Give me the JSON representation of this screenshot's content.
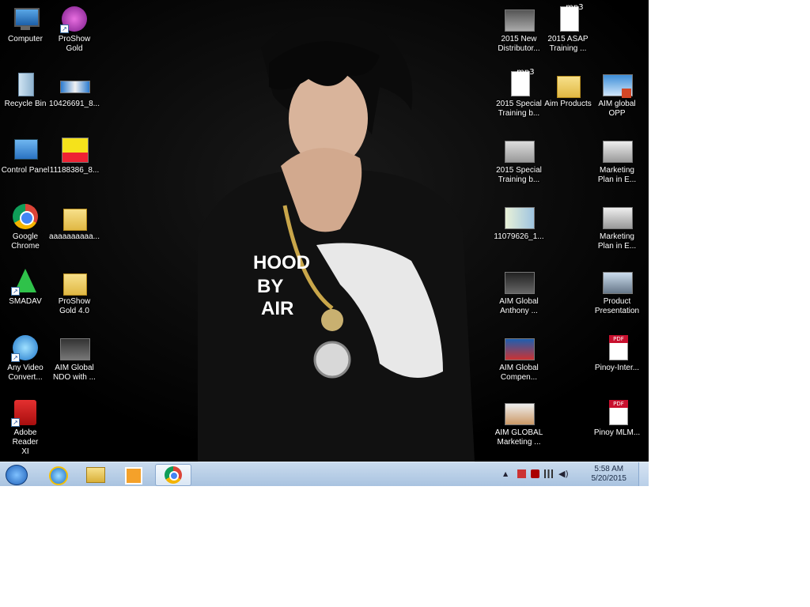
{
  "desktop": {
    "left_icons": [
      {
        "name": "computer",
        "label": "Computer"
      },
      {
        "name": "proshow-gold",
        "label": "ProShow\nGold"
      },
      {
        "name": "recycle-bin",
        "label": "Recycle Bin"
      },
      {
        "name": "file-10426691",
        "label": "10426691_8..."
      },
      {
        "name": "control-panel",
        "label": "Control Panel"
      },
      {
        "name": "file-11188386",
        "label": "11188386_8..."
      },
      {
        "name": "google-chrome",
        "label": "Google\nChrome"
      },
      {
        "name": "folder-aaaaa",
        "label": "aaaaaaaaaa..."
      },
      {
        "name": "smadav",
        "label": "SMADAV"
      },
      {
        "name": "proshow-gold-40",
        "label": "ProShow\nGold 4.0"
      },
      {
        "name": "any-video-converter",
        "label": "Any Video\nConvert..."
      },
      {
        "name": "aim-global-ndo",
        "label": "AIM Global\nNDO with ..."
      },
      {
        "name": "adobe-reader",
        "label": "Adobe Reader\nXI"
      }
    ],
    "right_icons": [
      {
        "name": "2015-new-distributor",
        "label": "2015 New\nDistributor..."
      },
      {
        "name": "2015-asap-training",
        "label": "2015 ASAP\nTraining ..."
      },
      {
        "name": "2015-special-training-mp3",
        "label": "2015 Special\nTraining b..."
      },
      {
        "name": "aim-products",
        "label": "Aim Products"
      },
      {
        "name": "aim-global-opp",
        "label": "AIM global\nOPP"
      },
      {
        "name": "2015-special-training-video",
        "label": "2015 Special\nTraining b..."
      },
      {
        "name": "marketing-plan-1",
        "label": "Marketing\nPlan in E..."
      },
      {
        "name": "file-11079626",
        "label": "11079626_1..."
      },
      {
        "name": "marketing-plan-2",
        "label": "Marketing\nPlan in E..."
      },
      {
        "name": "aim-global-anthony",
        "label": "AIM Global\nAnthony ..."
      },
      {
        "name": "product-presentation",
        "label": "Product\nPresentation"
      },
      {
        "name": "aim-global-compen",
        "label": "AIM Global\nCompen..."
      },
      {
        "name": "pinoy-inter",
        "label": "Pinoy-Inter..."
      },
      {
        "name": "aim-global-marketing",
        "label": "AIM GLOBAL\nMarketing ..."
      },
      {
        "name": "pinoy-mlm",
        "label": "Pinoy MLM..."
      }
    ],
    "mp3_badge": ".mp3",
    "pdf_badge": "PDF"
  },
  "taskbar": {
    "pinned": [
      "internet-explorer",
      "windows-explorer",
      "media-player",
      "google-chrome"
    ],
    "active": "google-chrome",
    "clock": {
      "time": "5:58 AM",
      "date": "5/20/2015"
    }
  },
  "colors": {
    "taskbar": "#b5cde6",
    "desktop": "#000000"
  }
}
